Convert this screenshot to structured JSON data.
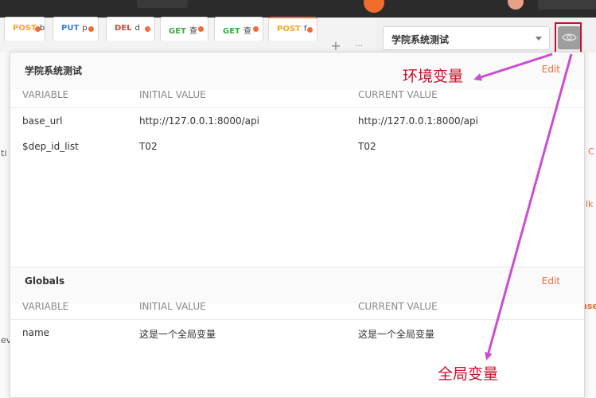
{
  "tabs": [
    {
      "method": "POST",
      "name": "b",
      "color": "#f5a623"
    },
    {
      "method": "PUT",
      "name": "p",
      "color": "#3d7bd9"
    },
    {
      "method": "DEL",
      "name": "d",
      "color": "#e0403a"
    },
    {
      "method": "GET",
      "name": "查",
      "color": "#3fa83f"
    },
    {
      "method": "GET",
      "name": "查",
      "color": "#3fa83f"
    },
    {
      "method": "POST",
      "name": "f",
      "color": "#f5a623"
    }
  ],
  "toolbar": {
    "add_tab": "+",
    "more_tabs": "···"
  },
  "environment": {
    "selected": "学院系统测试",
    "name": "学院系统测试",
    "edit": "Edit",
    "columns": [
      "VARIABLE",
      "INITIAL VALUE",
      "CURRENT VALUE"
    ],
    "variables": [
      {
        "variable": "base_url",
        "initial": "http://127.0.0.1:8000/api",
        "current": "http://127.0.0.1:8000/api"
      },
      {
        "variable": "$dep_id_list",
        "initial": "T02",
        "current": "T02"
      }
    ]
  },
  "globals": {
    "name": "Globals",
    "edit": "Edit",
    "columns": [
      "VARIABLE",
      "INITIAL VALUE",
      "CURRENT VALUE"
    ],
    "variables": [
      {
        "variable": "name",
        "initial": "这是一个全局变量",
        "current": "这是一个全局变量"
      }
    ]
  },
  "annotations": {
    "environment_label": "环境变量",
    "globals_label": "全局变量",
    "color": "#c8102e",
    "arrow_color": "#c84fd0"
  },
  "background_fragments": [
    "ti",
    "C",
    "lk",
    "nse",
    "ev"
  ]
}
